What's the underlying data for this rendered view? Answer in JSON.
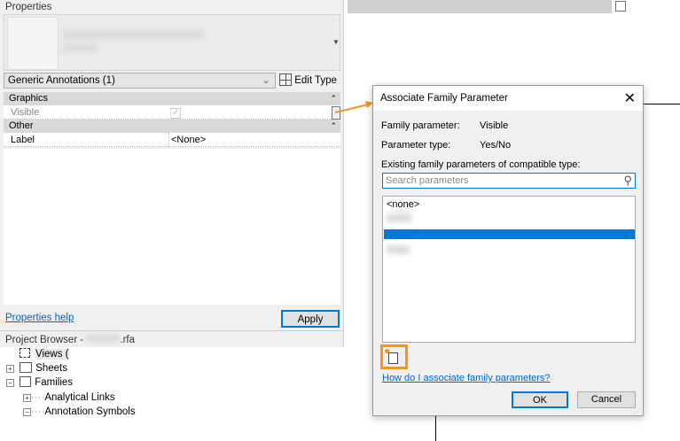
{
  "properties": {
    "title": "Properties",
    "type_selector": "Generic Annotations (1)",
    "edit_type": "Edit Type",
    "sections": [
      {
        "name": "Graphics",
        "rows": [
          {
            "label": "Visible",
            "value": "checked"
          }
        ]
      },
      {
        "name": "Other",
        "rows": [
          {
            "label": "Label",
            "value": "<None>"
          }
        ]
      }
    ],
    "help_link": "Properties help",
    "apply": "Apply"
  },
  "project_browser": {
    "title": "Project Browser - ",
    "file_suffix": ".rfa",
    "items": [
      {
        "label": "Views (",
        "expander": ""
      },
      {
        "label": "Sheets",
        "expander": "+"
      },
      {
        "label": "Families",
        "expander": "−"
      },
      {
        "label": "Analytical Links",
        "expander": "+"
      },
      {
        "label": "Annotation Symbols",
        "expander": "−"
      }
    ]
  },
  "dialog": {
    "title": "Associate Family Parameter",
    "family_parameter_label": "Family parameter:",
    "family_parameter_value": "Visible",
    "parameter_type_label": "Parameter type:",
    "parameter_type_value": "Yes/No",
    "existing_label": "Existing family parameters of compatible type:",
    "search_placeholder": "Search parameters",
    "list_first": "<none>",
    "help_link": "How do I associate family parameters?",
    "ok": "OK",
    "cancel": "Cancel"
  },
  "colors": {
    "accent": "#0078d7",
    "highlight": "#f7931e"
  }
}
